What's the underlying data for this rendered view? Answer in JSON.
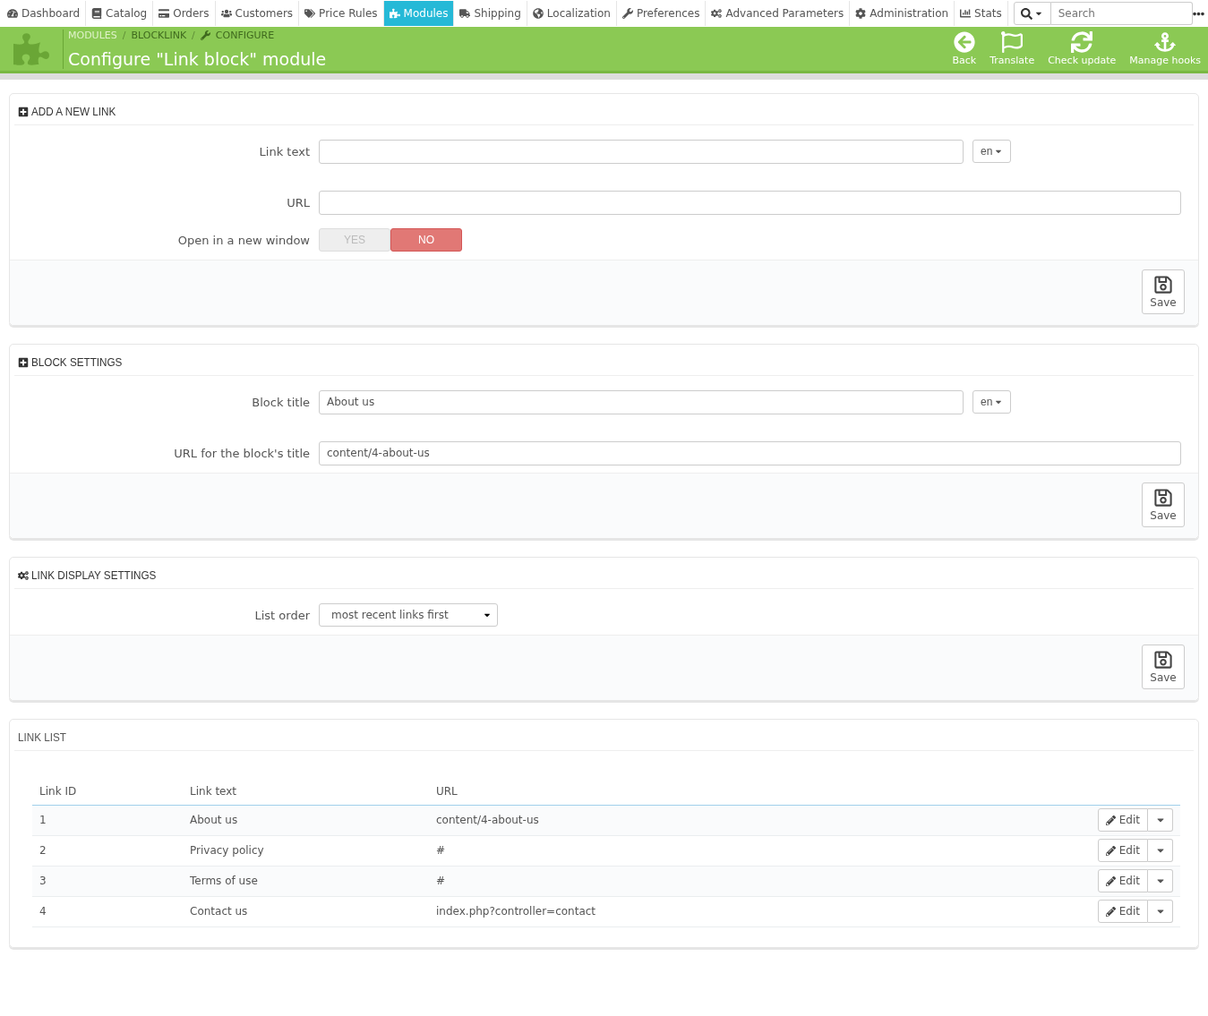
{
  "nav": {
    "items": [
      {
        "label": "Dashboard",
        "selected": false
      },
      {
        "label": "Catalog",
        "selected": false
      },
      {
        "label": "Orders",
        "selected": false
      },
      {
        "label": "Customers",
        "selected": false
      },
      {
        "label": "Price Rules",
        "selected": false
      },
      {
        "label": "Modules",
        "selected": true
      },
      {
        "label": "Shipping",
        "selected": false
      },
      {
        "label": "Localization",
        "selected": false
      },
      {
        "label": "Preferences",
        "selected": false
      },
      {
        "label": "Advanced Parameters",
        "selected": false
      },
      {
        "label": "Administration",
        "selected": false
      },
      {
        "label": "Stats",
        "selected": false
      }
    ],
    "search": {
      "placeholder": "Search"
    }
  },
  "header": {
    "breadcrumb": [
      "MODULES",
      "BLOCKLINK",
      "CONFIGURE"
    ],
    "separator": "/",
    "title": "Configure \"Link block\" module",
    "actions": [
      "Back",
      "Translate",
      "Check update",
      "Manage hooks"
    ]
  },
  "panels": [
    {
      "kind": "form",
      "title": "ADD A NEW LINK",
      "fields": [
        {
          "kind": "text",
          "label": "Link text",
          "lang": "en"
        },
        {
          "kind": "text",
          "label": "URL"
        },
        {
          "kind": "toggle",
          "label": "Open in a new window",
          "options": [
            {
              "label": "YES",
              "selected": false
            },
            {
              "label": "NO",
              "selected": true
            }
          ]
        }
      ],
      "button": "Save"
    },
    {
      "kind": "form",
      "title": "BLOCK SETTINGS",
      "fields": [
        {
          "kind": "text",
          "label": "Block title",
          "value": "About us",
          "lang": "en"
        },
        {
          "kind": "text",
          "label": "URL for the block's title",
          "value": "content/4-about-us"
        }
      ],
      "button": "Save"
    },
    {
      "kind": "form",
      "title": "LINK DISPLAY SETTINGS",
      "fields": [
        {
          "kind": "select",
          "label": "List order",
          "value": "most recent links first"
        }
      ],
      "button": "Save"
    },
    {
      "kind": "list",
      "title": "LINK LIST",
      "columns": [
        "Link ID",
        "Link text",
        "URL"
      ],
      "rows": [
        {
          "cells": [
            "1",
            "About us",
            "content/4-about-us"
          ],
          "action": "Edit"
        },
        {
          "cells": [
            "2",
            "Privacy policy",
            "#"
          ],
          "action": "Edit"
        },
        {
          "cells": [
            "3",
            "Terms of use",
            "#"
          ],
          "action": "Edit"
        },
        {
          "cells": [
            "4",
            "Contact us",
            "index.php?controller=contact"
          ],
          "action": "Edit"
        }
      ]
    }
  ]
}
